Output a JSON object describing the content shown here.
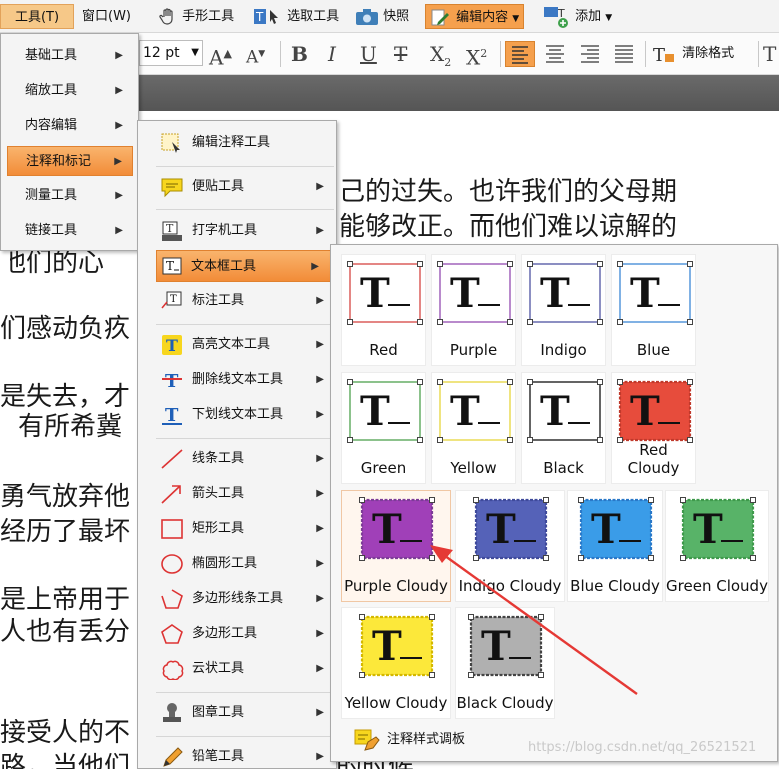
{
  "toolbar1": {
    "tools_menu": "工具(T)",
    "window_menu": "窗口(W)",
    "hand_tool": "手形工具",
    "select_tool": "选取工具",
    "snapshot": "快照",
    "edit_content": "编辑内容",
    "add": "添加"
  },
  "toolbar2": {
    "font_size": "12 pt",
    "grow_font": "A",
    "shrink_font": "A",
    "bold": "B",
    "italic": "I",
    "underline": "U",
    "strike": "T",
    "subscript": "X",
    "superscript": "X",
    "clear_format": "清除格式",
    "trailing": "T"
  },
  "document": {
    "lines": [
      "自己的过失。也许我们的父母期",
      "们能够改正。而他们难以谅解的",
      "他们的心",
      "们感动负疚",
      "是失去，才",
      "有所希冀",
      "勇气放弃他",
      "经历了最坏",
      "是上帝用于",
      "人也有丢分",
      "接受人的不",
      "路，当他们",
      "的时候"
    ]
  },
  "menu_tools": {
    "items": [
      {
        "label": "基础工具"
      },
      {
        "label": "缩放工具"
      },
      {
        "label": "内容编辑"
      },
      {
        "label": "注释和标记"
      },
      {
        "label": "测量工具"
      },
      {
        "label": "链接工具"
      }
    ]
  },
  "menu_annotate": {
    "items": [
      {
        "label": "编辑注释工具",
        "icon": "edit-annotation-icon"
      },
      {
        "label": "便贴工具",
        "icon": "sticky-note-icon"
      },
      {
        "label": "打字机工具",
        "icon": "typewriter-icon"
      },
      {
        "label": "文本框工具",
        "icon": "textbox-icon"
      },
      {
        "label": "标注工具",
        "icon": "callout-icon"
      },
      {
        "label": "高亮文本工具",
        "icon": "highlight-text-icon"
      },
      {
        "label": "删除线文本工具",
        "icon": "strikethrough-text-icon"
      },
      {
        "label": "下划线文本工具",
        "icon": "underline-text-icon"
      },
      {
        "label": "线条工具",
        "icon": "line-icon"
      },
      {
        "label": "箭头工具",
        "icon": "arrow-icon"
      },
      {
        "label": "矩形工具",
        "icon": "rectangle-icon"
      },
      {
        "label": "椭圆形工具",
        "icon": "ellipse-icon"
      },
      {
        "label": "多边形线条工具",
        "icon": "polyline-icon"
      },
      {
        "label": "多边形工具",
        "icon": "polygon-icon"
      },
      {
        "label": "云状工具",
        "icon": "cloud-icon"
      },
      {
        "label": "图章工具",
        "icon": "stamp-icon"
      },
      {
        "label": "铅笔工具",
        "icon": "pencil-icon"
      }
    ]
  },
  "textbox_styles": {
    "tiles": [
      {
        "label": "Red",
        "stroke": "#d9534f",
        "fill": "#ffffff",
        "cloudy": false
      },
      {
        "label": "Purple",
        "stroke": "#9b59b6",
        "fill": "#ffffff",
        "cloudy": false
      },
      {
        "label": "Indigo",
        "stroke": "#5a5fa8",
        "fill": "#ffffff",
        "cloudy": false
      },
      {
        "label": "Blue",
        "stroke": "#4a90d9",
        "fill": "#ffffff",
        "cloudy": false
      },
      {
        "label": "Green",
        "stroke": "#5aa85a",
        "fill": "#ffffff",
        "cloudy": false
      },
      {
        "label": "Yellow",
        "stroke": "#e8d84a",
        "fill": "#ffffff",
        "cloudy": false
      },
      {
        "label": "Black",
        "stroke": "#222222",
        "fill": "#ffffff",
        "cloudy": false
      },
      {
        "label": "Red Cloudy",
        "stroke": "#c0392b",
        "fill": "#e74c3c",
        "cloudy": true
      },
      {
        "label": "Purple Cloudy",
        "stroke": "#7d3c98",
        "fill": "#a040b8",
        "cloudy": true
      },
      {
        "label": "Indigo Cloudy",
        "stroke": "#3f4a9b",
        "fill": "#5562b8",
        "cloudy": true
      },
      {
        "label": "Blue Cloudy",
        "stroke": "#2a78c8",
        "fill": "#3a9ce8",
        "cloudy": true
      },
      {
        "label": "Green Cloudy",
        "stroke": "#3f9a4c",
        "fill": "#58b368",
        "cloudy": true
      },
      {
        "label": "Yellow Cloudy",
        "stroke": "#d4b800",
        "fill": "#fce83a",
        "cloudy": true
      },
      {
        "label": "Black Cloudy",
        "stroke": "#444444",
        "fill": "#b0b0b0",
        "cloudy": true
      }
    ],
    "footer": "注释样式调板"
  },
  "watermark": "https://blog.csdn.net/qq_26521521",
  "colors": {
    "accent": "#f28c38",
    "arrow": "#e53935"
  }
}
